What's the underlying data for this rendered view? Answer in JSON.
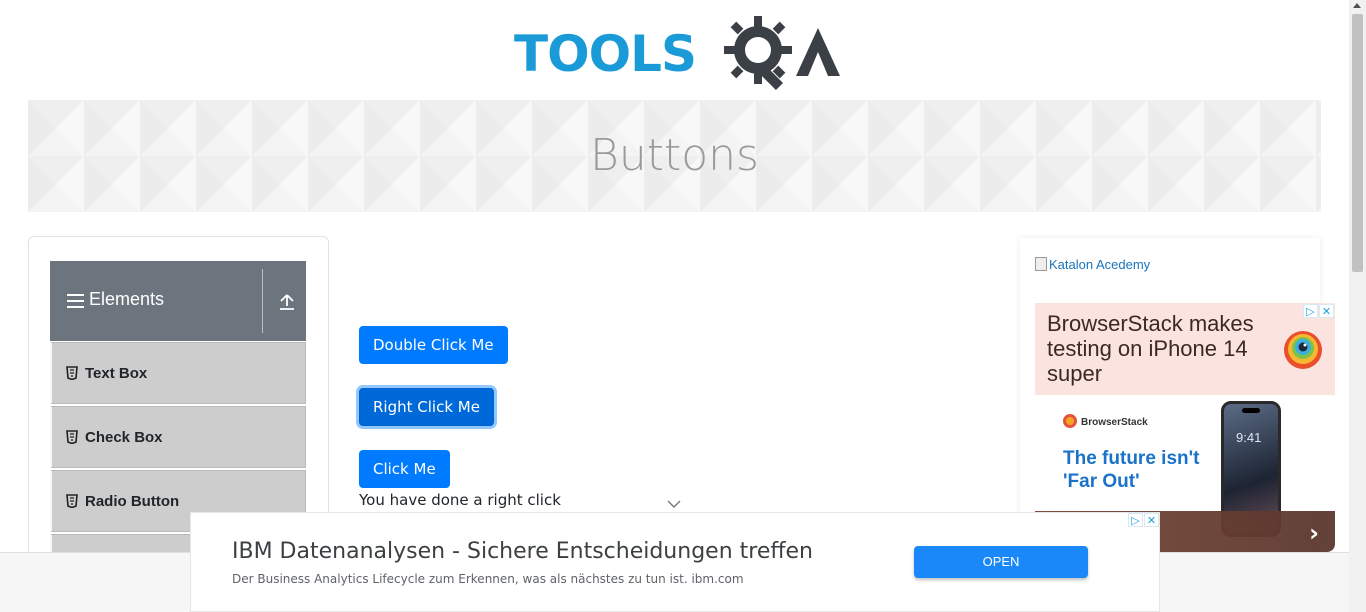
{
  "header": {
    "logo_text": "TOOLS",
    "logo_suffix": "QA"
  },
  "banner": {
    "title": "Buttons"
  },
  "sidebar": {
    "group_title": "Elements",
    "items": [
      {
        "label": "Text Box",
        "icon": "html5-icon"
      },
      {
        "label": "Check Box",
        "icon": "html5-icon"
      },
      {
        "label": "Radio Button",
        "icon": "html5-icon"
      }
    ]
  },
  "main": {
    "double_click_label": "Double Click Me",
    "right_click_label": "Right Click Me",
    "click_label": "Click Me",
    "message": "You have done a right click"
  },
  "right_ad": {
    "katalon_alt": "Katalon Acedemy",
    "headline": "BrowserStack makes testing on iPhone 14 super",
    "brand": "BrowserStack",
    "tagline": "The future isn't 'Far Out'",
    "phone_time": "9:41"
  },
  "bottom_ad": {
    "title": "IBM Datenanalysen - Sichere Entscheidungen treffen",
    "subtitle": "Der Business Analytics Lifecycle zum Erkennen, was als nächstes zu tun ist. ibm.com",
    "cta": "OPEN"
  },
  "colors": {
    "primary": "#007bff",
    "brand_blue": "#1b9ad8",
    "sidebar_header": "#6c757d",
    "menu_item_bg": "#cdcdcd"
  }
}
